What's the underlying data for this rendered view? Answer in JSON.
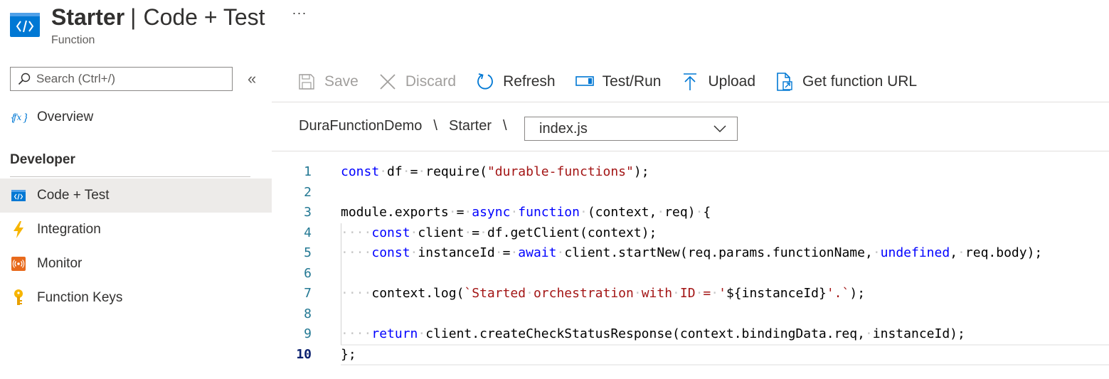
{
  "header": {
    "title_main": "Starter",
    "title_sep": "|",
    "title_sub": "Code + Test",
    "more": "···",
    "subtitle": "Function"
  },
  "sidebar": {
    "search_placeholder": "Search (Ctrl+/)",
    "collapse": "«",
    "overview": {
      "label": "Overview",
      "icon": "function-fx-icon"
    },
    "section_heading": "Developer",
    "items": [
      {
        "label": "Code + Test",
        "icon": "code-icon",
        "active": true
      },
      {
        "label": "Integration",
        "icon": "lightning-icon",
        "active": false
      },
      {
        "label": "Monitor",
        "icon": "monitor-icon",
        "active": false
      },
      {
        "label": "Function Keys",
        "icon": "key-icon",
        "active": false
      }
    ]
  },
  "toolbar": {
    "save": "Save",
    "discard": "Discard",
    "refresh": "Refresh",
    "test_run": "Test/Run",
    "upload": "Upload",
    "get_url": "Get function URL"
  },
  "breadcrumb": {
    "app": "DuraFunctionDemo",
    "function": "Starter",
    "sep": "\\",
    "file": "index.js"
  },
  "editor": {
    "current_line": 10,
    "lines": [
      {
        "n": "1",
        "tokens": [
          [
            "kw",
            "const"
          ],
          [
            "ws",
            "·"
          ],
          [
            "t",
            "df"
          ],
          [
            "ws",
            "·"
          ],
          [
            "t",
            "="
          ],
          [
            "ws",
            "·"
          ],
          [
            "t",
            "require("
          ],
          [
            "str",
            "\"durable-functions\""
          ],
          [
            "t",
            ");"
          ]
        ]
      },
      {
        "n": "2",
        "tokens": []
      },
      {
        "n": "3",
        "tokens": [
          [
            "t",
            "module.exports"
          ],
          [
            "ws",
            "·"
          ],
          [
            "t",
            "="
          ],
          [
            "ws",
            "·"
          ],
          [
            "kw",
            "async"
          ],
          [
            "ws",
            "·"
          ],
          [
            "kw",
            "function"
          ],
          [
            "ws",
            "·"
          ],
          [
            "t",
            "(context,"
          ],
          [
            "ws",
            "·"
          ],
          [
            "t",
            "req)"
          ],
          [
            "ws",
            "·"
          ],
          [
            "t",
            "{"
          ]
        ]
      },
      {
        "n": "4",
        "tokens": [
          [
            "ws",
            "····"
          ],
          [
            "kw",
            "const"
          ],
          [
            "ws",
            "·"
          ],
          [
            "t",
            "client"
          ],
          [
            "ws",
            "·"
          ],
          [
            "t",
            "="
          ],
          [
            "ws",
            "·"
          ],
          [
            "t",
            "df.getClient(context);"
          ]
        ]
      },
      {
        "n": "5",
        "tokens": [
          [
            "ws",
            "····"
          ],
          [
            "kw",
            "const"
          ],
          [
            "ws",
            "·"
          ],
          [
            "t",
            "instanceId"
          ],
          [
            "ws",
            "·"
          ],
          [
            "t",
            "="
          ],
          [
            "ws",
            "·"
          ],
          [
            "kw",
            "await"
          ],
          [
            "ws",
            "·"
          ],
          [
            "t",
            "client.startNew(req.params.functionName,"
          ],
          [
            "ws",
            "·"
          ],
          [
            "kw",
            "undefined"
          ],
          [
            "t",
            ","
          ],
          [
            "ws",
            "·"
          ],
          [
            "t",
            "req.body);"
          ]
        ]
      },
      {
        "n": "6",
        "tokens": []
      },
      {
        "n": "7",
        "tokens": [
          [
            "ws",
            "····"
          ],
          [
            "t",
            "context.log("
          ],
          [
            "str",
            "`Started"
          ],
          [
            "ws",
            "·"
          ],
          [
            "str",
            "orchestration"
          ],
          [
            "ws",
            "·"
          ],
          [
            "str",
            "with"
          ],
          [
            "ws",
            "·"
          ],
          [
            "str",
            "ID"
          ],
          [
            "ws",
            "·"
          ],
          [
            "str",
            "="
          ],
          [
            "ws",
            "·"
          ],
          [
            "str",
            "'"
          ],
          [
            "t",
            "${instanceId}"
          ],
          [
            "str",
            "'.`"
          ],
          [
            "t",
            ");"
          ]
        ]
      },
      {
        "n": "8",
        "tokens": []
      },
      {
        "n": "9",
        "tokens": [
          [
            "ws",
            "····"
          ],
          [
            "kw",
            "return"
          ],
          [
            "ws",
            "·"
          ],
          [
            "t",
            "client.createCheckStatusResponse(context.bindingData.req,"
          ],
          [
            "ws",
            "·"
          ],
          [
            "t",
            "instanceId);"
          ]
        ]
      },
      {
        "n": "10",
        "tokens": [
          [
            "t",
            "};"
          ]
        ]
      }
    ]
  },
  "colors": {
    "accent": "#0078d4",
    "keyword": "#0000ff",
    "string": "#a31515",
    "line_number": "#237893",
    "active_nav_bg": "#edebe9"
  }
}
